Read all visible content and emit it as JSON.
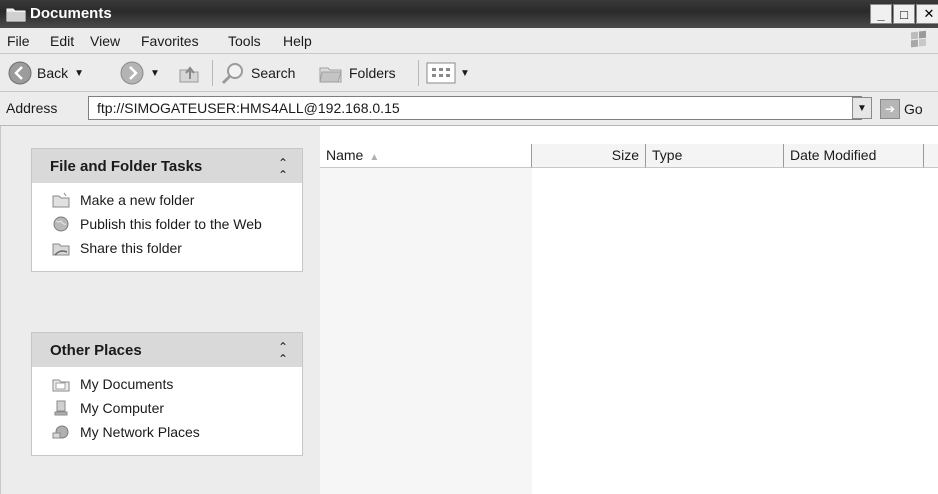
{
  "window": {
    "title": "Documents",
    "buttons": {
      "minimize": "_",
      "maximize": "□",
      "close": "✕"
    }
  },
  "menu": [
    "File",
    "Edit",
    "View",
    "Favorites",
    "Tools",
    "Help"
  ],
  "toolbar": {
    "back": "Back",
    "search": "Search",
    "folders": "Folders"
  },
  "address": {
    "label": "Address",
    "value": "ftp://SIMOGATEUSER:HMS4ALL@192.168.0.15",
    "go": "Go"
  },
  "tasks_panel": {
    "title": "File and Folder Tasks",
    "items": [
      {
        "label": "Make a new folder",
        "icon": "new-folder-icon"
      },
      {
        "label": "Publish this folder to the Web",
        "icon": "globe-icon"
      },
      {
        "label": "Share this folder",
        "icon": "share-icon"
      }
    ]
  },
  "places_panel": {
    "title": "Other Places",
    "items": [
      {
        "label": "My Documents",
        "icon": "my-documents-icon"
      },
      {
        "label": "My Computer",
        "icon": "my-computer-icon"
      },
      {
        "label": "My Network Places",
        "icon": "network-places-icon"
      }
    ]
  },
  "columns": [
    "Name",
    "Size",
    "Type",
    "Date Modified"
  ],
  "colors": {
    "titlebar": "#2e2e2e",
    "chrome": "#ececec",
    "panel_header": "#d9d9d9"
  }
}
